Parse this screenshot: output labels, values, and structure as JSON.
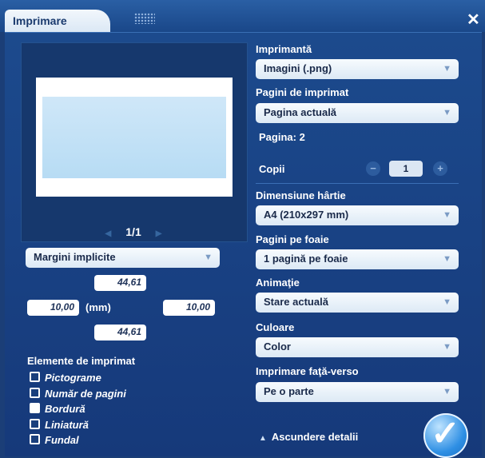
{
  "window": {
    "tab_title": "Imprimare",
    "close_glyph": "✕"
  },
  "preview": {
    "page_indicator": "1/1",
    "prev_arrow": "◀",
    "next_arrow": "▶"
  },
  "margins": {
    "preset": "Margini implicite",
    "top": "44,61",
    "left": "10,00",
    "unit": "(mm)",
    "right": "10,00",
    "bottom": "44,61"
  },
  "elements": {
    "heading": "Elemente de imprimat",
    "items": [
      {
        "label": "Pictograme",
        "checked": false
      },
      {
        "label": "Număr de pagini",
        "checked": false
      },
      {
        "label": "Bordură",
        "checked": true
      },
      {
        "label": "Liniatură",
        "checked": false
      },
      {
        "label": "Fundal",
        "checked": false
      }
    ]
  },
  "settings": {
    "printer_label": "Imprimantă",
    "printer_value": "Imagini (.png)",
    "pages_label": "Pagini de imprimat",
    "pages_value": "Pagina actuală",
    "page_info": "Pagina: 2",
    "copies_label": "Copii",
    "copies_value": "1",
    "minus": "−",
    "plus": "+",
    "paper_label": "Dimensiune hârtie",
    "paper_value": "A4 (210x297 mm)",
    "per_sheet_label": "Pagini pe foaie",
    "per_sheet_value": "1 pagină pe foaie",
    "animation_label": "Animaţie",
    "animation_value": "Stare actuală",
    "color_label": "Culoare",
    "color_value": "Color",
    "duplex_label": "Imprimare faţă-verso",
    "duplex_value": "Pe o parte",
    "dropdown_arrow": "▼"
  },
  "footer": {
    "details_arrow": "▲",
    "details_label": "Ascundere detalii",
    "ok_glyph": "✓"
  },
  "colors": {
    "background": "#1b3e77",
    "accent": "#2e8fe4",
    "field": "#dce9f5"
  }
}
